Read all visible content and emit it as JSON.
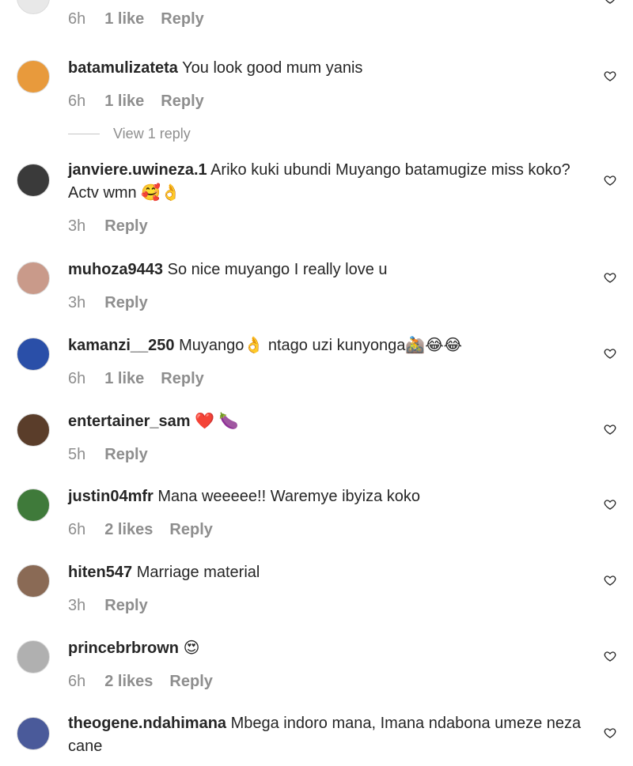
{
  "comments": [
    {
      "username": "",
      "text": "",
      "time": "6h",
      "likes": "1 like",
      "reply": "Reply",
      "avatar_color": "#e8e8e8"
    },
    {
      "username": "batamulizateta",
      "text": "You look good mum yanis",
      "time": "6h",
      "likes": "1 like",
      "reply": "Reply",
      "avatar_color": "#e89a3c"
    },
    {
      "username": "janviere.uwineza.1",
      "text": "Ariko kuki ubundi Muyango batamugize miss koko? Actv wmn 🥰👌",
      "time": "3h",
      "likes": "",
      "reply": "Reply",
      "avatar_color": "#3a3a3a"
    },
    {
      "username": "muhoza9443",
      "text": "So nice muyango I really love u",
      "time": "3h",
      "likes": "",
      "reply": "Reply",
      "avatar_color": "#c99a8a"
    },
    {
      "username": "kamanzi__250",
      "text": "Muyango👌 ntago uzi kunyonga🚵😂😂",
      "time": "6h",
      "likes": "1 like",
      "reply": "Reply",
      "avatar_color": "#2a4fa8"
    },
    {
      "username": "entertainer_sam",
      "text": "❤️ 🍆",
      "time": "5h",
      "likes": "",
      "reply": "Reply",
      "avatar_color": "#5a3d2a"
    },
    {
      "username": "justin04mfr",
      "text": "Mana weeeee!! Waremye ibyiza koko",
      "time": "6h",
      "likes": "2 likes",
      "reply": "Reply",
      "avatar_color": "#3f7a3a"
    },
    {
      "username": "hiten547",
      "text": "Marriage material",
      "time": "3h",
      "likes": "",
      "reply": "Reply",
      "avatar_color": "#8a6a55"
    },
    {
      "username": "princebrbrown",
      "text": "😍",
      "time": "6h",
      "likes": "2 likes",
      "reply": "Reply",
      "avatar_color": "#b0b0b0"
    },
    {
      "username": "theogene.ndahimana",
      "text": "Mbega indoro mana, Imana ndabona umeze neza cane",
      "time": "",
      "likes": "",
      "reply": "",
      "avatar_color": "#4a5a9a"
    }
  ],
  "view_replies": "View 1 reply",
  "icons": {
    "like": "heart-outline-icon"
  },
  "colors": {
    "text": "#262626",
    "meta": "#8e8e8e"
  }
}
